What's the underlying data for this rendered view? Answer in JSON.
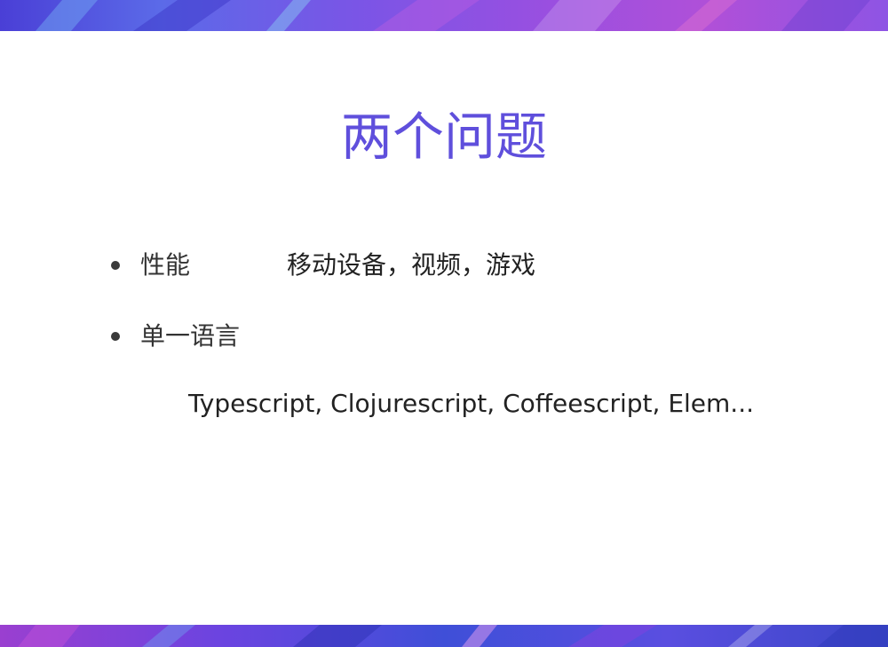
{
  "slide": {
    "title": "两个问题",
    "bullets": [
      {
        "label": "性能",
        "detail": "移动设备，视频，游戏"
      },
      {
        "label": "单一语言",
        "detail": ""
      }
    ],
    "sub_text": "Typescript, Clojurescript, Coffeescript, Elem..."
  },
  "colors": {
    "title": "#5f4fdc",
    "text": "#333333",
    "band_primary": "#5b4fe0",
    "band_accent": "#b050d8"
  }
}
